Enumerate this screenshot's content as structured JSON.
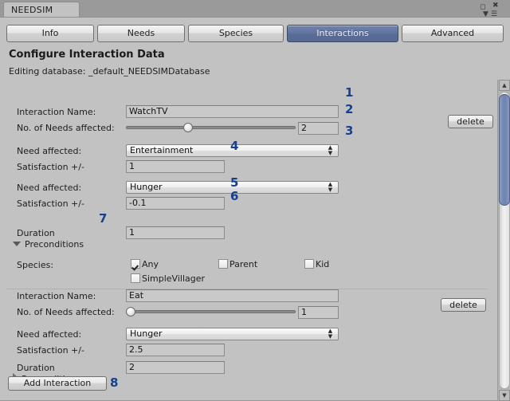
{
  "window": {
    "tab_label": "NEEDSIM",
    "restore_icon": "restore-icon",
    "close_icon": "close-icon",
    "menu_icon": "hamburger-menu-icon",
    "caret_icon": "caret-down-icon",
    "accent_color": "#5a6d99",
    "annotation_color": "#14408f"
  },
  "tabs": [
    {
      "label": "Info",
      "selected": false
    },
    {
      "label": "Needs",
      "selected": false
    },
    {
      "label": "Species",
      "selected": false
    },
    {
      "label": "Interactions",
      "selected": true
    },
    {
      "label": "Advanced",
      "selected": false
    }
  ],
  "header": {
    "title": "Configure Interaction Data",
    "subtitle": "Editing database: _default_NEEDSIMDatabase"
  },
  "labels": {
    "interaction_name": "Interaction Name:",
    "needs_affected": "No. of Needs affected:",
    "need_affected": "Need affected:",
    "satisfaction": "Satisfaction +/-",
    "duration": "Duration",
    "preconditions": "Preconditions",
    "species": "Species:",
    "delete": "delete"
  },
  "interactions": [
    {
      "name": "WatchTV",
      "needs_count": "2",
      "slider_fraction": 0.37,
      "needs": [
        {
          "need": "Entertainment",
          "satisfaction": "1"
        },
        {
          "need": "Hunger",
          "satisfaction": "-0.1"
        }
      ],
      "duration": "1",
      "preconditions_open": true,
      "species_options": [
        {
          "label": "Any",
          "checked": true
        },
        {
          "label": "Parent",
          "checked": false
        },
        {
          "label": "Kid",
          "checked": false
        },
        {
          "label": "SimpleVillager",
          "checked": false
        }
      ],
      "delete_label": "delete"
    },
    {
      "name": "Eat",
      "needs_count": "1",
      "slider_fraction": 0.0,
      "needs": [
        {
          "need": "Hunger",
          "satisfaction": "2.5"
        }
      ],
      "duration": "2",
      "preconditions_open": false,
      "species_options": [],
      "delete_label": "delete"
    }
  ],
  "footer": {
    "add_interaction": "Add Interaction"
  },
  "annotations": [
    {
      "n": "1"
    },
    {
      "n": "2"
    },
    {
      "n": "3"
    },
    {
      "n": "4"
    },
    {
      "n": "5"
    },
    {
      "n": "6"
    },
    {
      "n": "7"
    },
    {
      "n": "8"
    }
  ],
  "scrollbar": {
    "up_arrow": "▲",
    "down_arrow": "▼"
  }
}
